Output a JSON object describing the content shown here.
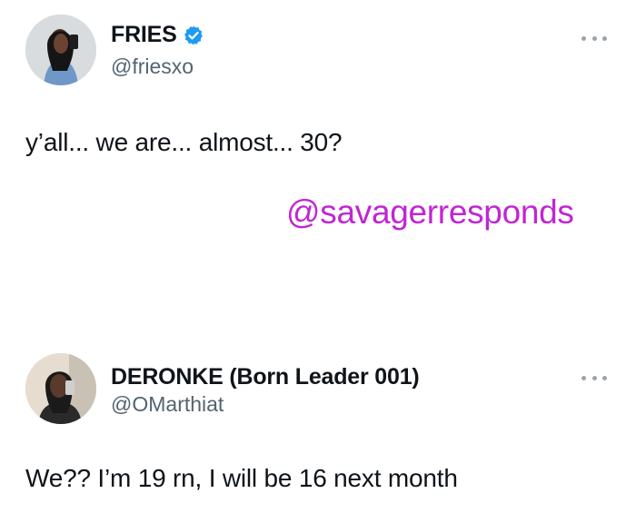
{
  "tweets": [
    {
      "display_name": "FRIES",
      "handle": "@friesxo",
      "verified": true,
      "text": "y’all... we are... almost... 30?"
    },
    {
      "display_name": "DERONKE (Born Leader 001)",
      "handle": "@OMarthiat",
      "verified": false,
      "text": "We?? I’m 19 rn, I will be 16 next month"
    }
  ],
  "watermark": "@savagerresponds",
  "colors": {
    "verified_badge": "#1d9bf0",
    "watermark": "#c026d3",
    "handle": "#536471"
  },
  "icons": [
    "verified-badge-icon",
    "more-options-icon"
  ]
}
